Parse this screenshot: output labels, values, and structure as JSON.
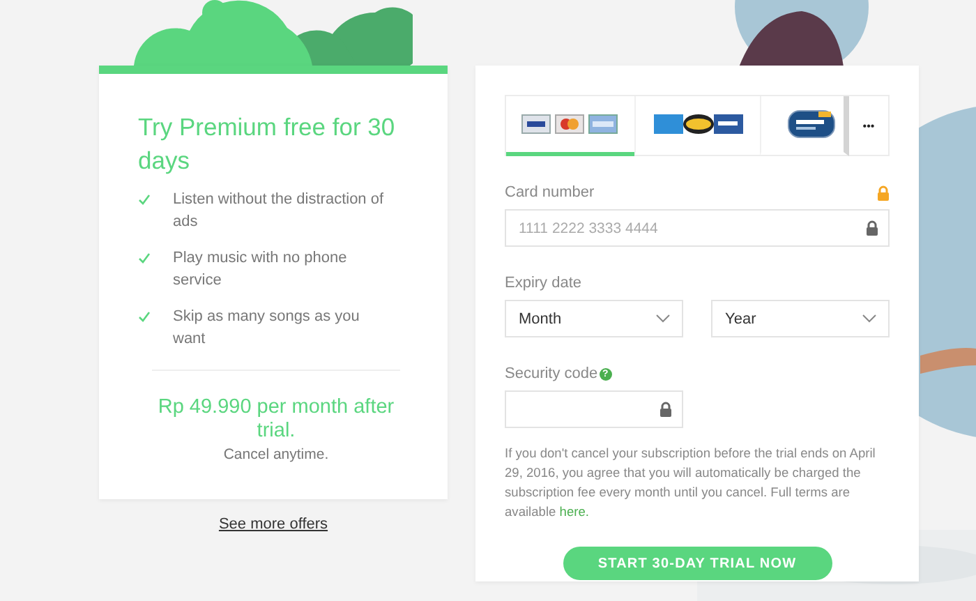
{
  "offer": {
    "title": "Try Premium free for 30 days",
    "features": [
      "Listen without the distraction of ads",
      "Play music with no phone service",
      "Skip as many songs as you want"
    ],
    "price": "Rp 49.990 per month after trial.",
    "note": "Cancel anytime."
  },
  "more_offers_link": "See more offers",
  "payment": {
    "methods": [
      {
        "kind": "cards",
        "selected": true
      },
      {
        "kind": "atm",
        "selected": false
      },
      {
        "kind": "mandiri",
        "selected": false
      }
    ],
    "more_button": "•••",
    "card_number": {
      "label": "Card number",
      "placeholder": "1111 2222 3333 4444"
    },
    "expiry": {
      "label": "Expiry date",
      "month": "Month",
      "year": "Year"
    },
    "security_code": {
      "label": "Security code",
      "help": "?"
    },
    "terms_text": "If you don't cancel your subscription before the trial ends on April 29, 2016, you agree that you will automatically be charged the subscription fee every month until you cancel. Full terms are available ",
    "terms_link": "here.",
    "submit": "START 30-DAY TRIAL NOW"
  }
}
